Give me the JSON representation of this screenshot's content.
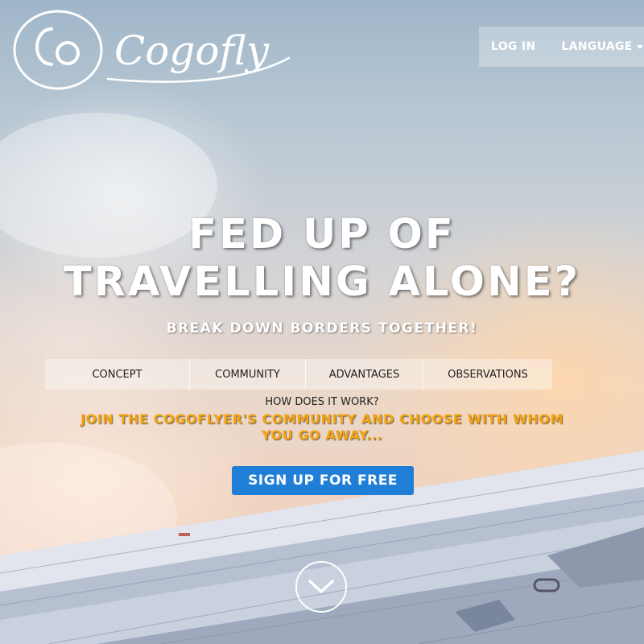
{
  "brand": {
    "name": "Cogofly",
    "logo_text": "Cogofly"
  },
  "topnav": {
    "login": "LOG IN",
    "language": "LANGUAGE"
  },
  "hero": {
    "headline_line1": "FED UP OF",
    "headline_line2": "TRAVELLING ALONE?",
    "tagline": "BREAK DOWN BORDERS TOGETHER!"
  },
  "tabs": [
    {
      "label": "CONCEPT"
    },
    {
      "label": "COMMUNITY"
    },
    {
      "label": "ADVANTAGES"
    },
    {
      "label": "OBSERVATIONS"
    }
  ],
  "section": {
    "question": "HOW DOES IT WORK?",
    "join_line1": "JOIN THE COGOFLYER'S COMMUNITY AND CHOOSE WITH WHOM",
    "join_line2": "YOU GO AWAY..."
  },
  "cta": {
    "signup": "SIGN UP FOR FREE"
  },
  "icons": {
    "scroll": "chevron-down-icon",
    "language_caret": "caret-down-icon"
  },
  "colors": {
    "accent_orange": "#f5a30f",
    "button_blue": "#1f7ed6"
  }
}
